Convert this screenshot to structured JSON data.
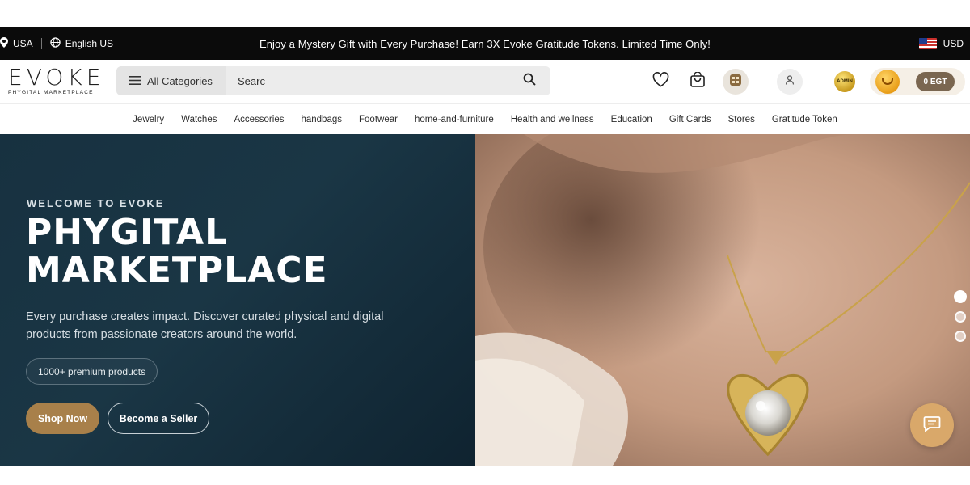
{
  "topbar": {
    "country": "USA",
    "language": "English US",
    "promo": "Enjoy a Mystery Gift with Every Purchase! Earn 3X Evoke Gratitude Tokens. Limited Time Only!",
    "currency": "USD"
  },
  "header": {
    "logo_text": "EVOKE",
    "logo_subtitle": "PHYGITAL MARKETPLACE",
    "categories_label": "All Categories",
    "search_value": "Searc",
    "admin_badge": "ADMIN",
    "egt_balance": "0 EGT"
  },
  "catnav": {
    "items": [
      "Jewelry",
      "Watches",
      "Accessories",
      "handbags",
      "Footwear",
      "home-and-furniture",
      "Health and wellness",
      "Education",
      "Gift Cards",
      "Stores",
      "Gratitude Token"
    ]
  },
  "hero": {
    "kicker": "WELCOME TO EVOKE",
    "headline_line1": "PHYGITAL",
    "headline_line2": "MARKETPLACE",
    "description": "Every purchase creates impact. Discover curated physical and digital products from passionate creators around the world.",
    "pill": "1000+ premium products",
    "primary_cta": "Shop Now",
    "secondary_cta": "Become a Seller",
    "slides": 3,
    "active_slide": 1
  },
  "colors": {
    "topbar_bg": "#0b0b0b",
    "hero_bg": "#173140",
    "accent_gold": "#a8804a",
    "chat_button": "#d9a86a"
  },
  "icons": [
    "location-pin-icon",
    "globe-icon",
    "us-flag-icon",
    "menu-icon",
    "search-icon",
    "heart-icon",
    "cart-icon",
    "store-icon",
    "user-icon",
    "coin-icon",
    "chat-icon"
  ]
}
